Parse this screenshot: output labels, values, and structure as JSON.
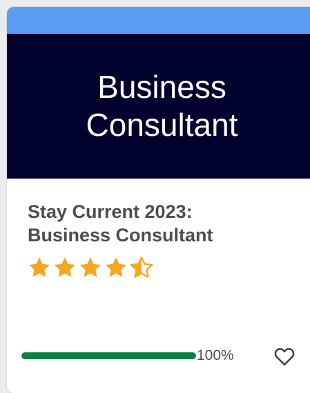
{
  "card": {
    "hero_lines": [
      "Business",
      "Consultant"
    ],
    "title_lines": [
      "Stay Current 2023:",
      "Business Consultant"
    ],
    "rating": 4.5,
    "rating_max": 5,
    "progress_percent": 100,
    "progress_label": "100%",
    "favorite_icon": "heart-outline-icon",
    "star_icon": "star-icon"
  },
  "colors": {
    "top_strip": "#5b9cf5",
    "hero_background": "#01012e",
    "hero_text": "#ffffff",
    "title_text": "#4a4e53",
    "star": "#f5a623",
    "progress_fill": "#0b8043",
    "progress_track": "#d9dde0"
  }
}
